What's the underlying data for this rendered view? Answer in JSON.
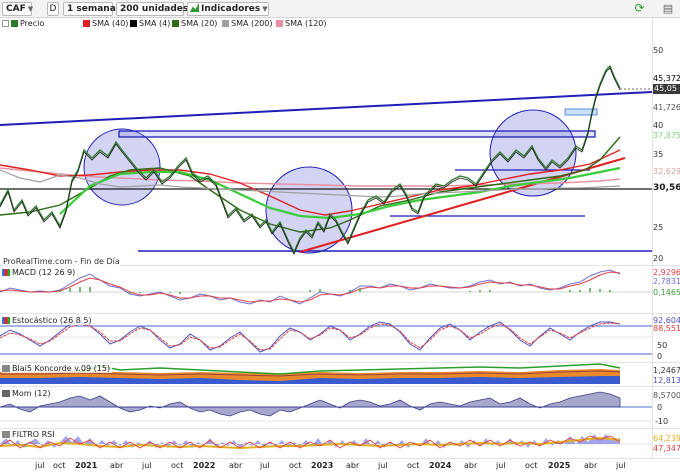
{
  "toolbar": {
    "symbol": "CAF",
    "d_label": "D",
    "timeframe": "1 semana",
    "units": "200 unidades",
    "indicators": "Indicadores"
  },
  "legend": [
    {
      "label": "Precio",
      "color": "#2a7a2a"
    },
    {
      "label": "SMA (40)",
      "color": "#e02020"
    },
    {
      "label": "SMA (4)",
      "color": "#000000"
    },
    {
      "label": "SMA (20)",
      "color": "#2f6a16"
    },
    {
      "label": "SMA (200)",
      "color": "#a0a0a0"
    },
    {
      "label": "SMA (120)",
      "color": "#e890a0"
    }
  ],
  "price_axis": {
    "ticks": [
      "50",
      "40",
      "35",
      "25",
      "20"
    ],
    "labels": [
      {
        "text": "45,372",
        "color": "#000000",
        "boxed": false
      },
      {
        "text": "45,05",
        "color": "#ffffff",
        "bg": "#3a3a3a",
        "boxed": true
      },
      {
        "text": "41,726",
        "color": "#555555",
        "boxed": false
      },
      {
        "text": "37,875",
        "color": "#7fd37f",
        "boxed": false
      },
      {
        "text": "32,629",
        "color": "#d9a0a0",
        "boxed": false
      },
      {
        "text": "30,56",
        "color": "#1a1a1a",
        "boxed": false,
        "bold": true
      }
    ]
  },
  "watermark": "ProRealTime.com - Fin de Día",
  "panels": {
    "macd": {
      "name": "MACD (12 26 9)",
      "values": [
        "2,9296",
        "2,7831",
        "0,1465"
      ],
      "value_colors": [
        "#e0404a",
        "#7070d0",
        "#3aa03a"
      ]
    },
    "stoch": {
      "name": "Estocástico (26 8 5)",
      "ticks": [
        "80",
        "50",
        "0"
      ],
      "values": [
        "92,604",
        "88,551"
      ],
      "value_colors": [
        "#5050c0",
        "#e04040"
      ]
    },
    "blai": {
      "name": "Blai5 Koncorde v.09 (15)",
      "values": [
        "1,2467",
        "12,813"
      ],
      "value_colors": [
        "#333333",
        "#5050c0"
      ]
    },
    "mom": {
      "name": "Mom (12)",
      "ticks": [
        "0",
        "-10"
      ],
      "values": [
        "8,5700"
      ],
      "value_colors": [
        "#555555"
      ]
    },
    "filtro": {
      "name": "FILTRO RSI",
      "values": [
        "64,239",
        "47,347"
      ],
      "value_colors": [
        "#e0b020",
        "#e04040"
      ]
    }
  },
  "x_axis": [
    {
      "label": "jul",
      "year": false
    },
    {
      "label": "oct",
      "year": false
    },
    {
      "label": "2021",
      "year": true
    },
    {
      "label": "abr",
      "year": false
    },
    {
      "label": "jul",
      "year": false
    },
    {
      "label": "oct",
      "year": false
    },
    {
      "label": "2022",
      "year": true
    },
    {
      "label": "abr",
      "year": false
    },
    {
      "label": "jul",
      "year": false
    },
    {
      "label": "oct",
      "year": false
    },
    {
      "label": "2023",
      "year": true
    },
    {
      "label": "abr",
      "year": false
    },
    {
      "label": "jul",
      "year": false
    },
    {
      "label": "oct",
      "year": false
    },
    {
      "label": "2024",
      "year": true
    },
    {
      "label": "abr",
      "year": false
    },
    {
      "label": "jul",
      "year": false
    },
    {
      "label": "oct",
      "year": false
    },
    {
      "label": "2025",
      "year": true
    },
    {
      "label": "abr",
      "year": false
    },
    {
      "label": "jul",
      "year": false
    }
  ]
}
